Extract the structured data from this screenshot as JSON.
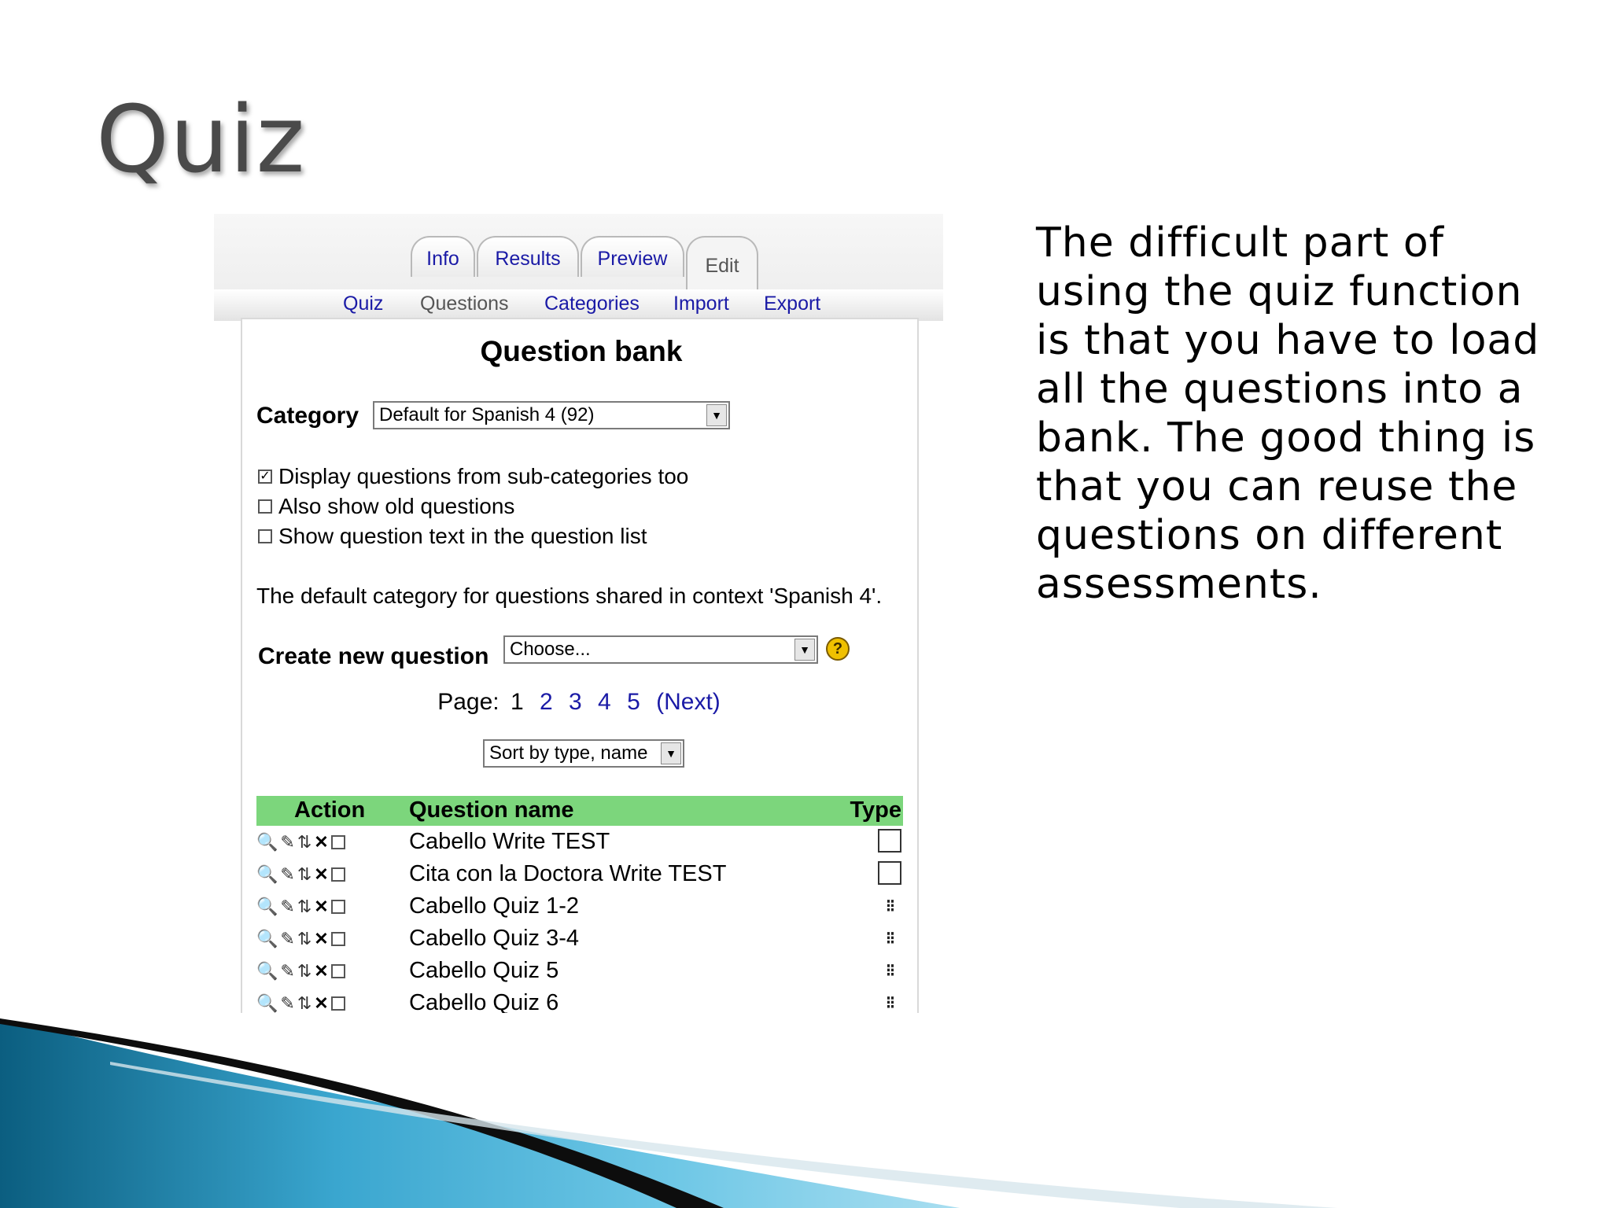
{
  "slide": {
    "title": "Quiz",
    "body": "The difficult part of using the quiz function is that you have to load all the questions into a bank. The good thing is that you can reuse the questions on different assessments."
  },
  "moodle": {
    "tabs": [
      {
        "label": "Info",
        "selected": false
      },
      {
        "label": "Results",
        "selected": false
      },
      {
        "label": "Preview",
        "selected": false
      },
      {
        "label": "Edit",
        "selected": true
      }
    ],
    "subtabs": [
      {
        "label": "Quiz",
        "current": false
      },
      {
        "label": "Questions",
        "current": true
      },
      {
        "label": "Categories",
        "current": false
      },
      {
        "label": "Import",
        "current": false
      },
      {
        "label": "Export",
        "current": false
      }
    ],
    "heading": "Question bank",
    "category_label": "Category",
    "category_value": "Default for Spanish 4 (92)",
    "options": [
      {
        "label": "Display questions from sub-categories too",
        "checked": true
      },
      {
        "label": "Also show old questions",
        "checked": false
      },
      {
        "label": "Show question text in the question list",
        "checked": false
      }
    ],
    "info_text": "The default category for questions shared in context 'Spanish 4'.",
    "create_label": "Create new question",
    "create_value": "Choose...",
    "pager": {
      "label": "Page:",
      "current": "1",
      "pages": [
        "2",
        "3",
        "4",
        "5"
      ],
      "next": "(Next)"
    },
    "sort_value": "Sort by type, name",
    "table": {
      "headers": {
        "action": "Action",
        "name": "Question name",
        "type": "Type"
      },
      "rows": [
        {
          "name": "Cabello Write TEST",
          "type": "essay"
        },
        {
          "name": "Cita con la Doctora Write TEST",
          "type": "essay"
        },
        {
          "name": "Cabello Quiz 1-2",
          "type": "multichoice"
        },
        {
          "name": "Cabello Quiz 3-4",
          "type": "multichoice"
        },
        {
          "name": "Cabello Quiz 5",
          "type": "multichoice"
        },
        {
          "name": "Cabello Quiz 6",
          "type": "multichoice"
        }
      ]
    }
  },
  "colors": {
    "link": "#1a1aa6",
    "table_header": "#7cd67c",
    "swoosh_dark": "#0b5e80",
    "swoosh_light": "#4fb8e0"
  },
  "icons": {
    "row_actions": [
      "preview-icon",
      "edit-icon",
      "move-icon",
      "delete-icon",
      "select-checkbox"
    ],
    "help": "help-icon",
    "dropdown": "chevron-down-icon"
  }
}
